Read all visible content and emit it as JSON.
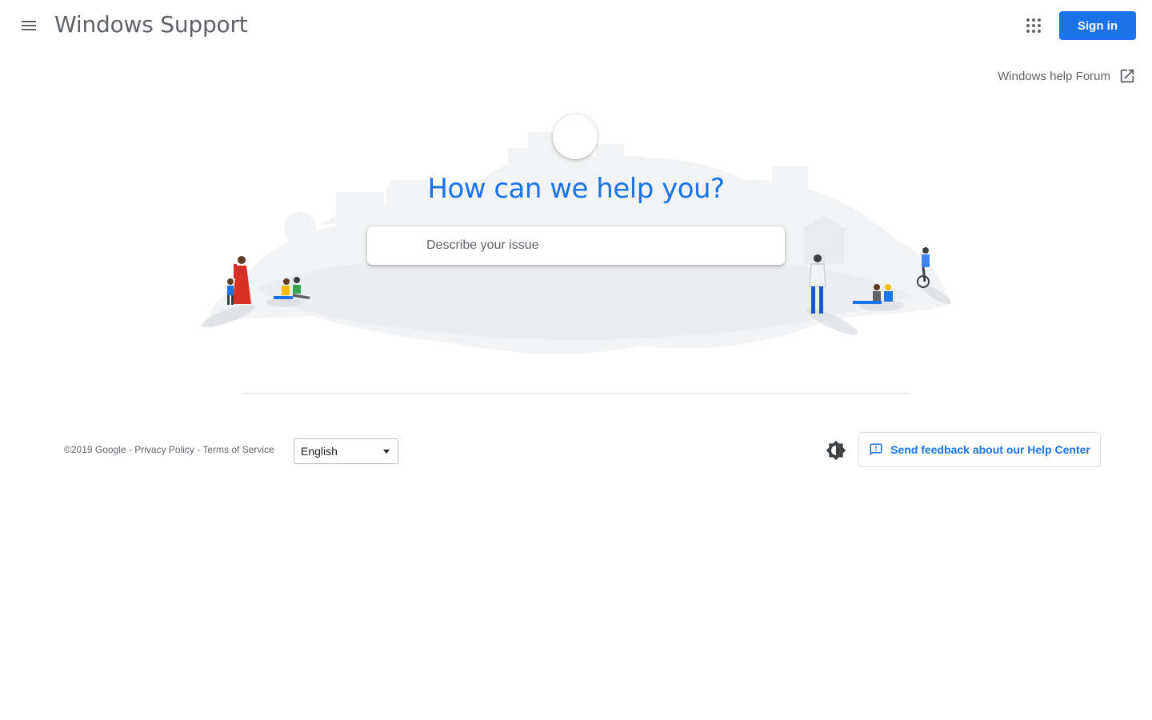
{
  "header": {
    "menu_icon": "hamburger-menu-icon",
    "title": "Windows Support",
    "apps_icon": "apps-grid-icon",
    "signin_label": "Sign in"
  },
  "forum": {
    "label": "Windows help Forum",
    "icon": "open-in-new-icon"
  },
  "hero": {
    "title": "How can we help you?",
    "search_placeholder": "Describe your issue"
  },
  "footer": {
    "copyright": "©2019 Google",
    "separator": " - ",
    "privacy_label": "Privacy Policy",
    "terms_label": "Terms of Service",
    "language": "English",
    "theme_icon": "brightness-contrast-icon",
    "feedback_icon": "feedback-icon",
    "feedback_label": "Send feedback about our Help Center"
  },
  "colors": {
    "accent": "#1a73e8",
    "text_secondary": "#5f6368",
    "divider": "#dadce0"
  }
}
